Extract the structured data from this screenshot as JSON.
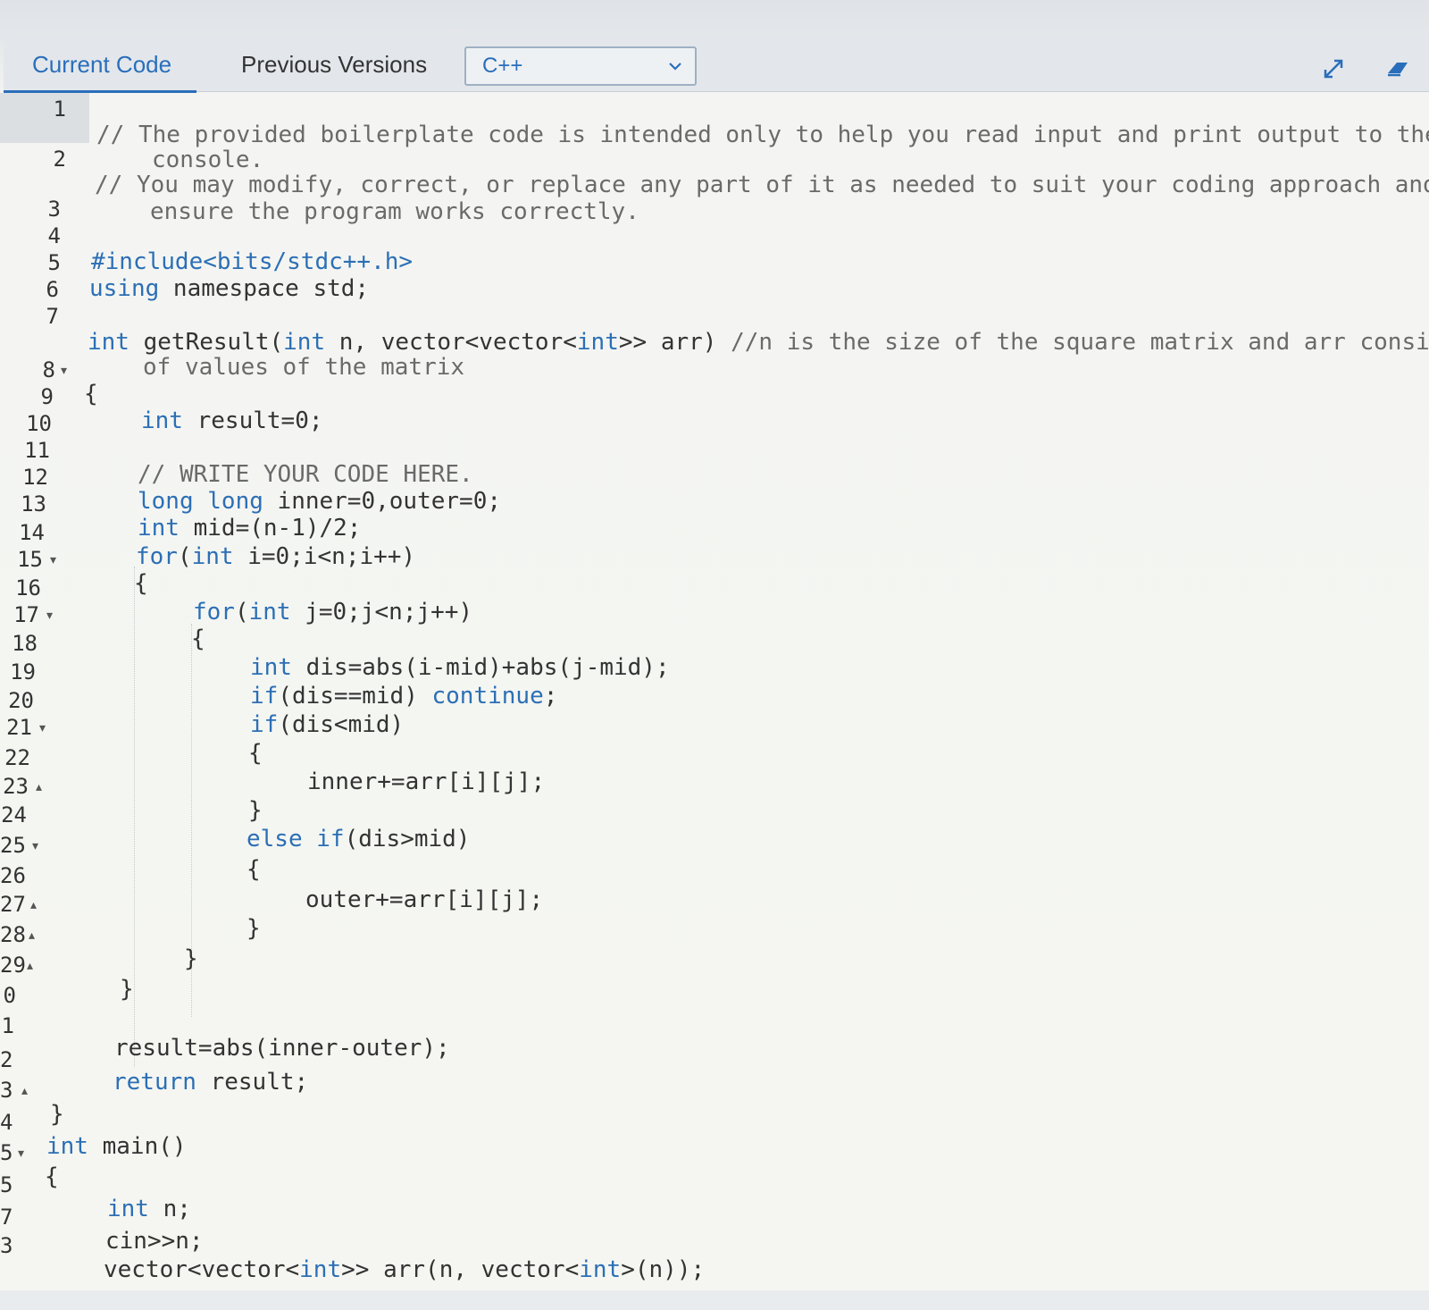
{
  "tabs": {
    "current": "Current Code",
    "previous": "Previous Versions"
  },
  "language": {
    "selected": "C++"
  },
  "icons": {
    "dropdown": "chevron-down-icon",
    "expand": "expand-icon",
    "eraser": "eraser-icon"
  },
  "colors": {
    "accent": "#2a6ebb",
    "keyword": "#2c6fb5",
    "comment": "#6a6a6a"
  },
  "code": {
    "l1a": "// The provided boilerplate code is intended only to help you read input and print output to the",
    "l1b": "console.",
    "l2a": "// You may modify, correct, or replace any part of it as needed to suit your coding approach and",
    "l2b": "ensure the program works correctly.",
    "l4": "#include<bits/stdc++.h>",
    "l5_kw": "using",
    "l5_rest": " namespace std;",
    "l7_kw": "int",
    "l7_a": " getResult(",
    "l7_kw2": "int",
    "l7_b": " n, vector<vector<",
    "l7_kw3": "int",
    "l7_c": ">> arr) ",
    "l7_cm": "//n is the size of the square matrix and arr consi",
    "l7_cont": "of values of the matrix",
    "l8": "{",
    "l9_kw": "int",
    "l9_rest": " result=0;",
    "l11": "// WRITE YOUR CODE HERE.",
    "l12_kw": "long long",
    "l12_rest": " inner=0,outer=0;",
    "l13_kw": "int",
    "l13_rest": " mid=(n-1)/2;",
    "l14_kw": "for",
    "l14_a": "(",
    "l14_kw2": "int",
    "l14_b": " i=0;i<n;i++)",
    "l15": "{",
    "l16_kw": "for",
    "l16_a": "(",
    "l16_kw2": "int",
    "l16_b": " j=0;j<n;j++)",
    "l17": "{",
    "l18_kw": "int",
    "l18_rest": " dis=abs(i-mid)+abs(j-mid);",
    "l19_kw": "if",
    "l19_a": "(dis==mid) ",
    "l19_kw2": "continue",
    "l19_b": ";",
    "l20_kw": "if",
    "l20_rest": "(dis<mid)",
    "l21": "{",
    "l22": "inner+=arr[i][j];",
    "l23": "}",
    "l24_kw": "else if",
    "l24_rest": "(dis>mid)",
    "l25": "{",
    "l26": "outer+=arr[i][j];",
    "l27": "}",
    "l28": "}",
    "l29": "}",
    "l31": "result=abs(inner-outer);",
    "l32_kw": "return",
    "l32_rest": " result;",
    "l33": "}",
    "l34_kw": "int",
    "l34_rest": " main()",
    "l35": "{",
    "l36_kw": "int",
    "l36_rest": " n;",
    "l37": "cin>>n;",
    "l38_a": "vector<vector<",
    "l38_kw": "int",
    "l38_b": ">> arr(n, vector<",
    "l38_kw2": "int",
    "l38_c": ">(n));"
  },
  "line_numbers": [
    "1",
    "2",
    "3",
    "4",
    "5",
    "6",
    "7",
    "8",
    "9",
    "10",
    "11",
    "12",
    "13",
    "14",
    "15",
    "16",
    "17",
    "18",
    "19",
    "20",
    "21",
    "22",
    "23",
    "24",
    "25",
    "26",
    "27",
    "28",
    "29",
    "0",
    "1",
    "2",
    "3",
    "4",
    "5",
    "5",
    "7",
    "3"
  ]
}
